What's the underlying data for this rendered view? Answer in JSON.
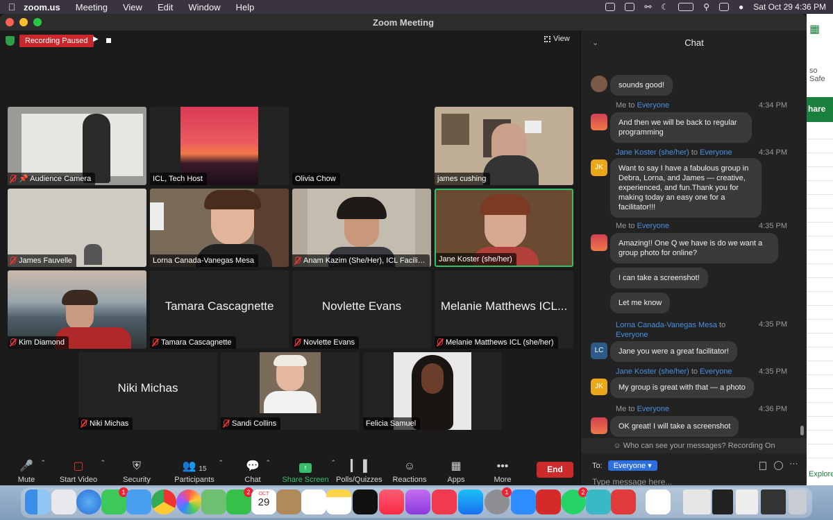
{
  "menubar": {
    "app": "zoom.us",
    "items": [
      "Meeting",
      "View",
      "Edit",
      "Window",
      "Help"
    ],
    "clock": "Sat Oct 29  4:36 PM"
  },
  "window": {
    "title": "Zoom Meeting"
  },
  "meeting": {
    "recording_label": "Recording Paused",
    "view_label": "View",
    "participants": [
      {
        "name": "Audience Camera",
        "muted": true,
        "pinned": true,
        "kind": "video",
        "scene": "whiteboard"
      },
      {
        "name": "ICL, Tech Host",
        "muted": false,
        "kind": "image",
        "scene": "sunset"
      },
      {
        "name": "Olivia Chow",
        "muted": false,
        "kind": "dark"
      },
      {
        "name": "james cushing",
        "muted": false,
        "kind": "video",
        "scene": "man-glasses"
      },
      {
        "name": "James Fauvelle",
        "muted": true,
        "kind": "video",
        "scene": "room"
      },
      {
        "name": "Lorna Canada-Vanegas Mesa",
        "muted": false,
        "kind": "video",
        "scene": "woman-kitchen"
      },
      {
        "name": "Anam Kazim (She/Her), ICL Facilitat...",
        "muted": true,
        "kind": "video",
        "scene": "woman-headphones"
      },
      {
        "name": "Jane Koster (she/her)",
        "muted": false,
        "kind": "video",
        "scene": "woman-red",
        "active": true
      },
      {
        "name": "Kim Diamond",
        "muted": true,
        "kind": "video",
        "scene": "lake"
      },
      {
        "name": "Tamara Cascagnette",
        "display": "Tamara Cascagnette",
        "muted": true,
        "kind": "name"
      },
      {
        "name": "Novlette Evans",
        "display": "Novlette Evans",
        "muted": true,
        "kind": "name"
      },
      {
        "name": "Melanie Matthews ICL (she/her)",
        "display": "Melanie Matthews ICL...",
        "muted": true,
        "kind": "name"
      },
      {
        "name": "Niki Michas",
        "display": "Niki Michas",
        "muted": true,
        "kind": "name"
      },
      {
        "name": "Sandi Collins",
        "muted": true,
        "kind": "image",
        "scene": "woman-white"
      },
      {
        "name": "Felicia Samuel",
        "muted": false,
        "kind": "image",
        "scene": "woman-curly"
      }
    ]
  },
  "toolbar": {
    "mute": "Mute",
    "start_video": "Start Video",
    "security": "Security",
    "participants": "Participants",
    "participants_count": "15",
    "chat": "Chat",
    "share_screen": "Share Screen",
    "polls": "Polls/Quizzes",
    "reactions": "Reactions",
    "apps": "Apps",
    "more": "More",
    "end": "End"
  },
  "chat": {
    "title": "Chat",
    "messages": [
      {
        "sender": "",
        "to": "",
        "time": "",
        "text": "sounds good!",
        "avatar": "photo"
      },
      {
        "sender": "Me",
        "to": "Everyone",
        "time": "4:34 PM",
        "text": "And then we will be back to regular programming",
        "avatar": "sunset"
      },
      {
        "sender": "Jane Koster (she/her)",
        "to": "Everyone",
        "time": "4:34 PM",
        "text": "Want to say I have a fabulous group in Debra, Lorna, and James — creative, experienced, and fun.Thank you for making today an easy one for a facilitator!!!",
        "avatar": "JK"
      },
      {
        "sender": "Me",
        "to": "Everyone",
        "time": "4:35 PM",
        "text": "Amazing!! One Q we have is do we want a group photo for online?",
        "avatar": "sunset"
      },
      {
        "sender": "",
        "to": "",
        "time": "",
        "text": "I can take a screenshot!",
        "avatar": ""
      },
      {
        "sender": "",
        "to": "",
        "time": "",
        "text": "Let me know",
        "avatar": ""
      },
      {
        "sender": "Lorna Canada-Vanegas Mesa",
        "to": "Everyone",
        "time": "4:35 PM",
        "text": "Jane you were a great facilitator!",
        "avatar": "LC"
      },
      {
        "sender": "Jane Koster (she/her)",
        "to": "Everyone",
        "time": "4:35 PM",
        "text": "My group is great with that — a photo",
        "avatar": "JK"
      },
      {
        "sender": "Me",
        "to": "Everyone",
        "time": "4:36 PM",
        "text": "OK great! I will take a screenshot",
        "avatar": "sunset"
      }
    ],
    "to_word": "to",
    "visibility_notice": "Who can see your messages? Recording On",
    "to_label": "To:",
    "recipient": "Everyone",
    "input_placeholder": "Type message here..."
  },
  "background_app": {
    "share_label": "hare",
    "visible_text": "so Safe",
    "explore_label": "Explore"
  },
  "dock": {
    "calendar_month": "OCT",
    "calendar_day": "29",
    "badges": {
      "messages": "1",
      "facetime": "2",
      "outlook": "1",
      "whatsapp": "2"
    },
    "icons": [
      "finder-icon",
      "launchpad-icon",
      "safari-icon",
      "messages-icon",
      "mail-icon",
      "chrome-icon",
      "photos-icon",
      "maps-icon",
      "facetime-icon",
      "calendar-icon",
      "contacts-icon",
      "reminders-icon",
      "notes-icon",
      "appletv-icon",
      "music-icon",
      "podcasts-icon",
      "news-icon",
      "appstore-icon",
      "settings-icon",
      "zoom-icon",
      "acrobat-icon",
      "whatsapp-icon",
      "teams-icon",
      "acrobat2-icon",
      "slack-icon",
      "trash-icon"
    ]
  }
}
